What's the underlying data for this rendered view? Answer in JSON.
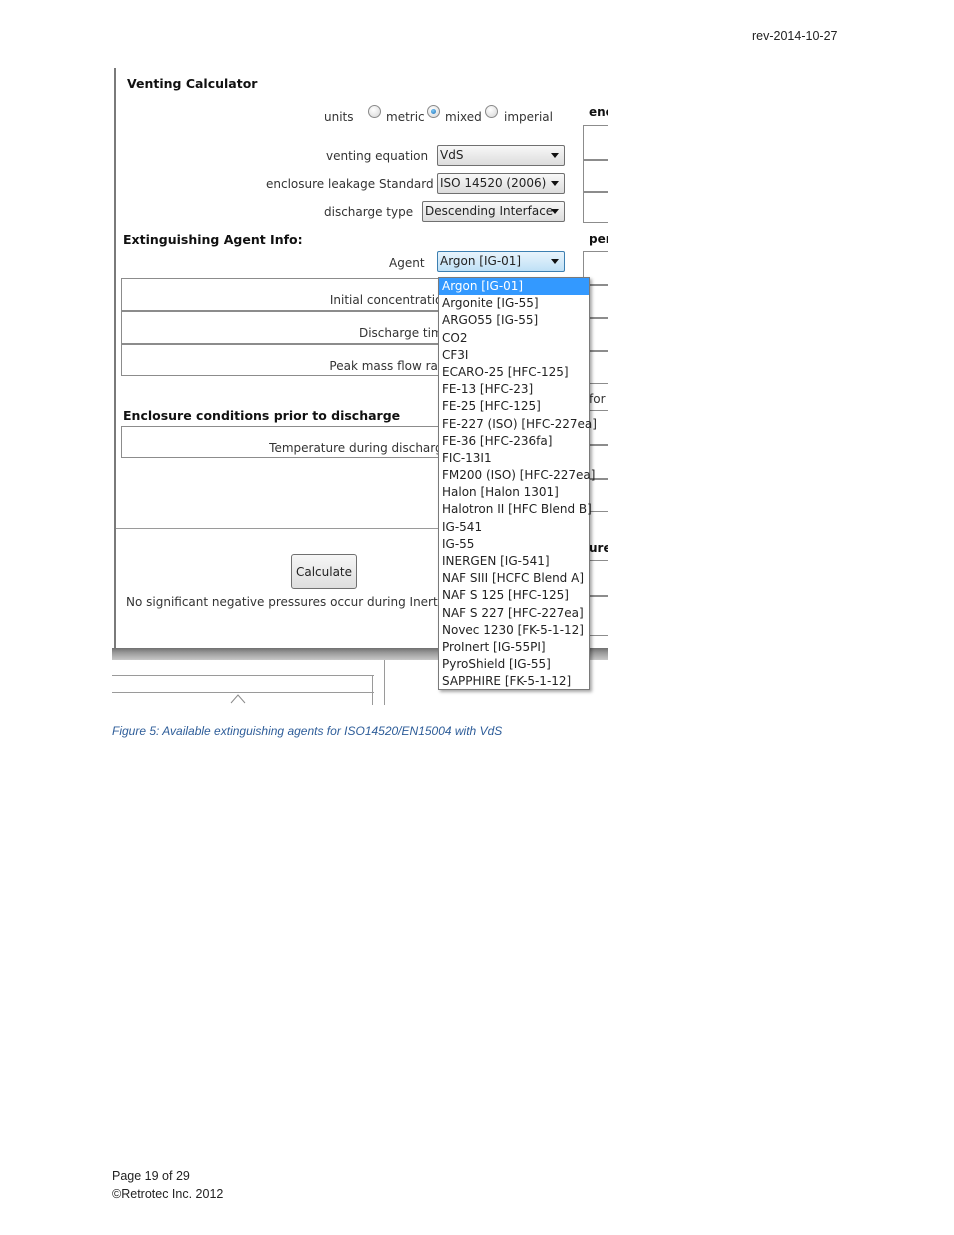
{
  "header": {
    "revision": "rev-2014-10-27"
  },
  "window": {
    "title": "Venting Calculator",
    "units": {
      "label": "units",
      "options": [
        "metric",
        "mixed",
        "imperial"
      ],
      "selected": "mixed"
    },
    "venting_equation": {
      "label": "venting equation",
      "value": "VdS"
    },
    "enclosure_leakage_standard": {
      "label": "enclosure leakage Standard",
      "value": "ISO 14520 (2006)"
    },
    "discharge_type": {
      "label": "discharge type",
      "value": "Descending Interface"
    },
    "agent_section": {
      "title": "Extinguishing Agent Info:",
      "agent_label": "Agent",
      "agent_value": "Argon [IG-01]",
      "rows": [
        "Initial concentration",
        "Discharge time",
        "Peak mass flow rate"
      ]
    },
    "enclosure_section": {
      "title": "Enclosure conditions prior to discharge",
      "rows": [
        "Temperature during discharge"
      ]
    },
    "calculate_label": "Calculate",
    "status_message": "No significant negative pressures occur during Inert Ag",
    "right_fragments": {
      "top": "enc",
      "mid": "per",
      "for": "for",
      "ure": "ure"
    },
    "dropdown_options": [
      "Argon [IG-01]",
      "Argonite [IG-55]",
      "ARGO55 [IG-55]",
      "CO2",
      "CF3I",
      "ECARO-25 [HFC-125]",
      "FE-13 [HFC-23]",
      "FE-25 [HFC-125]",
      "FE-227 (ISO) [HFC-227ea]",
      "FE-36 [HFC-236fa]",
      "FIC-13I1",
      "FM200 (ISO) [HFC-227ea]",
      "Halon [Halon 1301]",
      "Halotron II [HFC Blend B]",
      "IG-541",
      "IG-55",
      "INERGEN [IG-541]",
      "NAF SIII [HCFC Blend A]",
      "NAF S 125 [HFC-125]",
      "NAF S 227 [HFC-227ea]",
      "Novec 1230 [FK-5-1-12]",
      "ProInert [IG-55PI]",
      "PyroShield [IG-55]",
      "SAPPHIRE [FK-5-1-12]"
    ],
    "highlighted_option": "Argon [IG-01]"
  },
  "caption": "Figure 5:  Available extinguishing agents for ISO14520/EN15004 with VdS",
  "footer": {
    "page": "Page 19 of 29",
    "copyright": "©Retrotec Inc. 2012"
  }
}
